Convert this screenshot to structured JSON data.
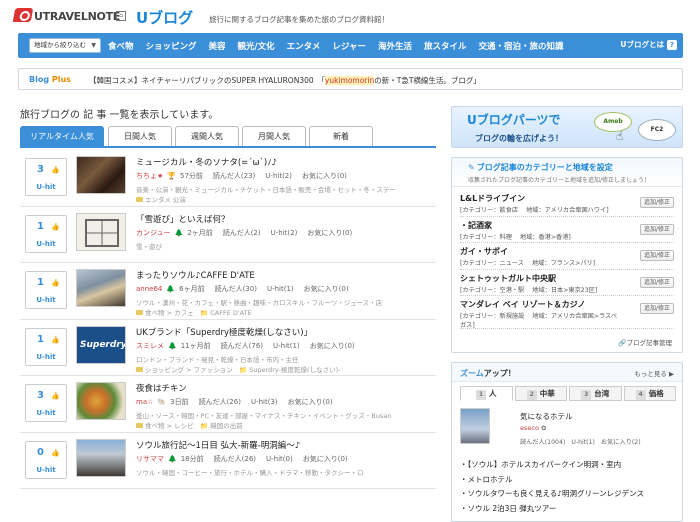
{
  "header": {
    "logo_text": "UTRAVELNOTE",
    "logo_home": "⌂",
    "brand": "Uブログ",
    "tagline": "旅行に関するブログ記事を集めた旅のブログ資料館！"
  },
  "nav": {
    "select_label": "地域から絞り込む",
    "items": [
      "食べ物",
      "ショッピング",
      "美容",
      "観光/文化",
      "エンタメ",
      "レジャー",
      "海外生活",
      "旅スタイル",
      "交通・宿泊・旅の知識"
    ],
    "about": "Uブログとは",
    "about_icon": "?"
  },
  "blog_plus": {
    "label_prefix": "Blog ",
    "label_suffix": "Plus",
    "text_a": "【韓国コスメ】ネイチャーリパブリックのSUPER HYALURON300　「",
    "text_highlight": "yukimomorin",
    "text_b": "の新・T急T横線生活。ブログ」"
  },
  "left": {
    "section_title": "旅行ブログの 記 事 一覧を表示しています。",
    "tabs": [
      "リアルタイム人気",
      "日間人気",
      "週間人気",
      "月間人気",
      "新着"
    ],
    "rows": [
      {
        "rank": "3",
        "uhit": "U-hit",
        "title": "ミュージカル・冬のソナタ(=´ω`)ﾉ♪",
        "author": "ちちょ★",
        "icon": "🏆",
        "age": "57分前",
        "read": "読んだ人(23)",
        "hits": "U-hit(2)",
        "fav": "お気に入り(0)",
        "tags": "音楽・公演・観光・ミュージカル・チケット・日本語・販売・会場・セット・冬・ステー",
        "cat": "エンタメ 公演"
      },
      {
        "rank": "1",
        "uhit": "U-hit",
        "title": "「雪遊び」といえば何？",
        "author": "カンジュー",
        "icon": "🌲",
        "age": "2ヶ月前",
        "read": "読んだ人(2)",
        "hits": "U-hit(2)",
        "fav": "お気に入り(0)",
        "tags": "雪・遊び",
        "cat": ""
      },
      {
        "rank": "1",
        "uhit": "U-hit",
        "title": "まったりソウル♪CAFFE D'ATE",
        "author": "anne64",
        "icon": "🌲",
        "age": "6ヶ月前",
        "read": "読んだ人(30)",
        "hits": "U-hit(1)",
        "fav": "お気に入り(0)",
        "tags": "ソウル・漢州・花・カフェ・駅・懸曲・趣味・カロスキル・フルーツ・ジュース・店",
        "cat": "食べ物 > カフェ　📁 CAFFE D'ATE"
      },
      {
        "rank": "1",
        "uhit": "U-hit",
        "title": "UKブランド「Superdry極度乾燥(しなさい)」",
        "author": "スミレメ",
        "icon": "🌲",
        "age": "11ヶ月前",
        "read": "読んだ人(76)",
        "hits": "U-hit(1)",
        "fav": "お気に入り(0)",
        "tags": "ロンドン・ブランド・発見・乾燥・日本語・市内・主任",
        "cat": "ショッピング > ファッション　📁 Superdry-極度乾燥(しなさい)-"
      },
      {
        "rank": "3",
        "uhit": "U-hit",
        "title": "夜食はチキン",
        "author": "ma☆",
        "icon": "🐚",
        "age": "3日前",
        "read": "読んだ人(26)",
        "hits": "U-hit(3)",
        "fav": "お気に入り(0)",
        "tags": "釜山・ソース・韓国・PC・友達・部屋・マイナス・チキン・イベント・グッズ・Busan",
        "cat": "食べ物 > レシピ　📁 韓国の出前"
      },
      {
        "rank": "0",
        "uhit": "U-hit",
        "title": "ソウル旅行記～1日目 弘大-新羅-明洞編～♪",
        "author": "リサママ",
        "icon": "🌲",
        "age": "18分前",
        "read": "読んだ人(26)",
        "hits": "U-hit(0)",
        "fav": "お気に入り(0)",
        "tags": "ソウル・韓国・コーヒー・旅行・ホテル・購入・ドラマ・移動・タクシー・ロ",
        "cat": ""
      }
    ]
  },
  "right": {
    "parts": {
      "title": "Uブログパーツで",
      "subtitle": "ブログの輪を広げよう！",
      "badge1": "Ameb",
      "badge2": "FC2"
    },
    "category_box": {
      "title": "ブログ記事のカテゴリーと地域を設定",
      "subtitle": "収集されたブログ記事のカテゴリーと地域を追加/修正しましょう！",
      "items": [
        {
          "name": "L&Lドライブイン",
          "category": "[カテゴリー：飲食店",
          "region": "地域：アメリカ合衆国ハワイ]"
        },
        {
          "name": "・記酒家",
          "category": "[カテゴリー：料理",
          "region": "地域：香港>香港]"
        },
        {
          "name": "ガイ・サボイ",
          "category": "[カテゴリー：ニュース",
          "region": "地域：フランス>パリ]"
        },
        {
          "name": "シェトゥットガルト中央駅",
          "category": "[カテゴリー：空港・駅",
          "region": "地域：日本>東京23区]"
        },
        {
          "name": "マンダレイ ベイ リゾート＆カジノ",
          "category": "[カテゴリー：新規施設",
          "region": "地域：アメリカ合衆国>ラスベ",
          "extra": "ガス]"
        }
      ],
      "edit_label": "追加/修正",
      "manage": "ブログ記事管理"
    },
    "zoom": {
      "title_a": "ズーム",
      "title_b": "アップ！",
      "more": "もっと見る",
      "tabs": [
        {
          "n": "1",
          "label": "人"
        },
        {
          "n": "2",
          "label": "中華"
        },
        {
          "n": "3",
          "label": "台湾"
        },
        {
          "n": "4",
          "label": "価格"
        }
      ],
      "item_title": "気になるホテル",
      "item_author": "eseco",
      "item_read": "読んだ人(1004)",
      "item_hit": "U-hit(1)",
      "item_fav": "お気に入り(2)",
      "links": [
        "【ソウル】ホテルスカイパークイン明洞・室内",
        "メトロホテル",
        "ソウルタワーも良く見える♪明洞グリーンレジデンス",
        "ソウル 2泊3日  弾丸ツアー"
      ]
    }
  }
}
